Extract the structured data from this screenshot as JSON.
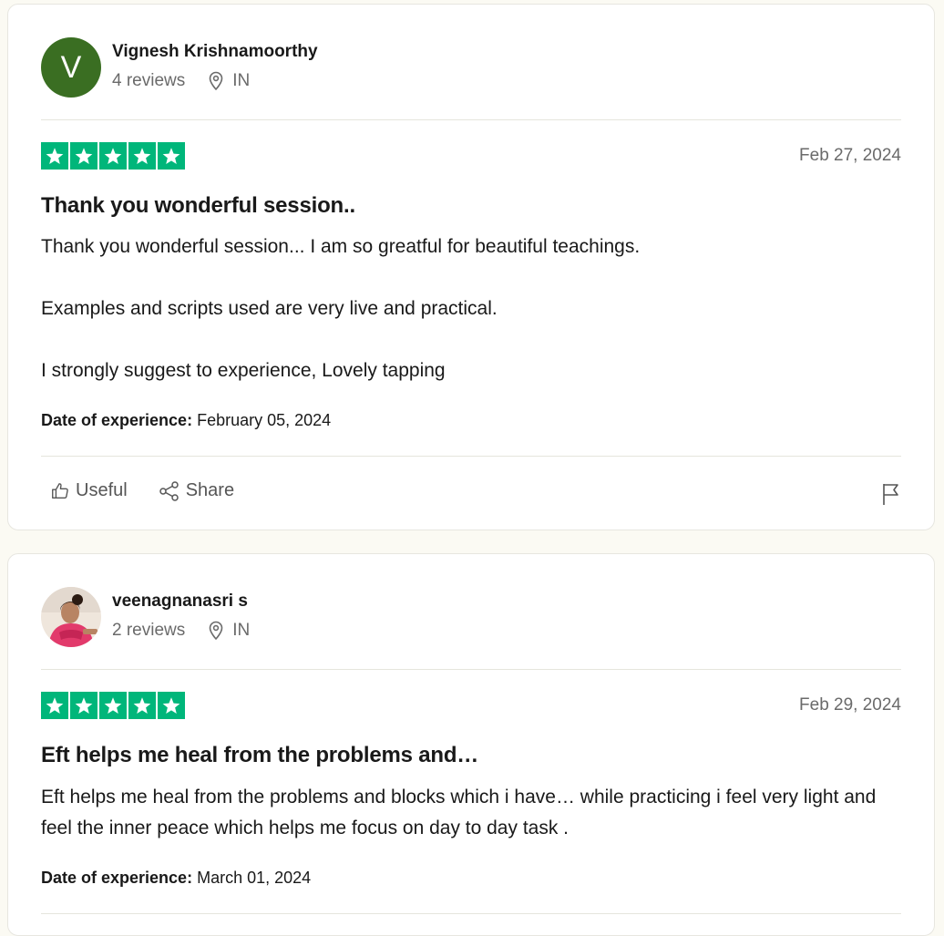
{
  "reviews": [
    {
      "reviewer_name": "Vignesh Krishnamoorthy",
      "avatar_letter": "V",
      "review_count": "4 reviews",
      "country": "IN",
      "rating": 5,
      "date": "Feb 27, 2024",
      "title": "Thank you wonderful session..",
      "paragraphs": [
        "Thank you wonderful session... I am so greatful for beautiful teachings.",
        "Examples and scripts used are very live and practical.",
        "I strongly suggest to experience, Lovely tapping"
      ],
      "experience_label": "Date of experience:",
      "experience_date": "February 05, 2024",
      "useful_label": "Useful",
      "share_label": "Share"
    },
    {
      "reviewer_name": "veenagnanasri s",
      "review_count": "2 reviews",
      "country": "IN",
      "rating": 5,
      "date": "Feb 29, 2024",
      "title": "Eft helps me heal from the problems and…",
      "paragraphs": [
        "Eft helps me heal from the problems and blocks which i have… while practicing i feel very light and feel the inner peace which helps me focus on day to day task ."
      ],
      "experience_label": "Date of experience:",
      "experience_date": "March 01, 2024"
    }
  ],
  "colors": {
    "star_green": "#00b67a",
    "avatar_green": "#3a6e22",
    "page_bg": "#fbfaf3"
  },
  "icons": [
    "location-pin-icon",
    "thumbs-up-icon",
    "share-icon",
    "flag-icon",
    "star-icon"
  ]
}
